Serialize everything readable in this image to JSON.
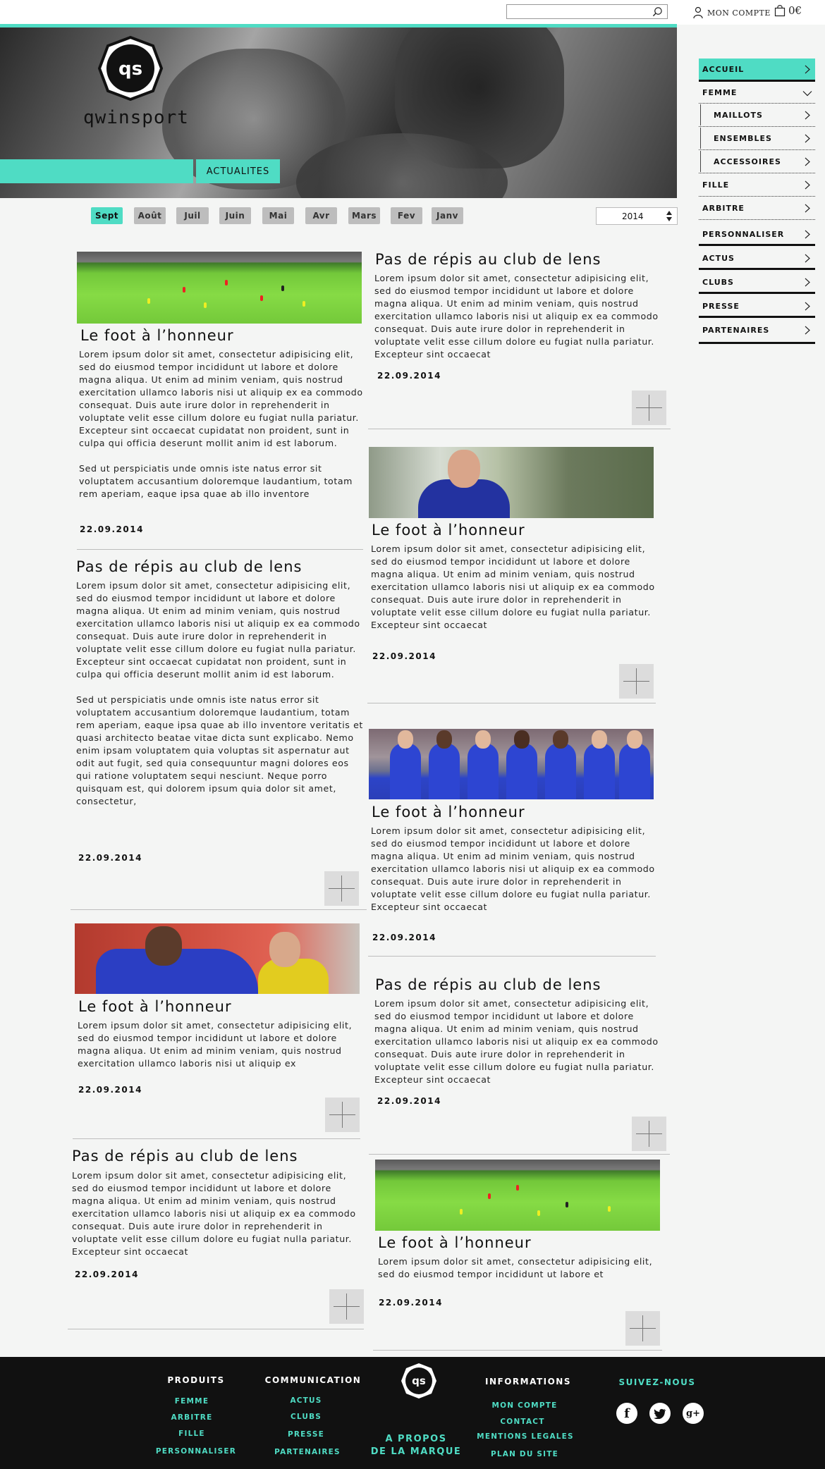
{
  "header": {
    "search_placeholder": "",
    "account_label": "MON COMPTE",
    "cart_total": "0€"
  },
  "hero": {
    "brand": "qwinsport",
    "logo_text": "qs",
    "section_tab": "ACTUALITES"
  },
  "filters": {
    "months": [
      "Sept",
      "Août",
      "Juil",
      "Juin",
      "Mai",
      "Avr",
      "Mars",
      "Fev",
      "Janv"
    ],
    "active_month": "Sept",
    "year": "2014"
  },
  "sidebar": {
    "items": [
      {
        "label": "ACCUEIL"
      },
      {
        "label": "FEMME"
      },
      {
        "label": "MAILLOTS"
      },
      {
        "label": "ENSEMBLES"
      },
      {
        "label": "ACCESSOIRES"
      },
      {
        "label": "FILLE"
      },
      {
        "label": "ARBITRE"
      },
      {
        "label": "PERSONNALISER"
      },
      {
        "label": "ACTUS"
      },
      {
        "label": "CLUBS"
      },
      {
        "label": "PRESSE"
      },
      {
        "label": "PARTENAIRES"
      }
    ]
  },
  "articles": [
    {
      "title": "Le foot à l’honneur",
      "paragraphs": [
        "Lorem ipsum dolor sit amet, consectetur adipisicing elit, sed do eiusmod tempor incididunt ut labore et dolore magna aliqua. Ut enim ad minim veniam, quis nostrud exercitation ullamco laboris nisi ut aliquip ex ea commodo consequat. Duis aute irure dolor in reprehenderit in voluptate velit esse cillum dolore eu fugiat nulla pariatur. Excepteur sint occaecat cupidatat non proident, sunt in culpa qui officia deserunt mollit anim id est laborum.",
        "Sed ut perspiciatis unde omnis iste natus error sit voluptatem accusantium doloremque laudantium, totam rem aperiam, eaque ipsa quae ab illo inventore"
      ],
      "date": "22.09.2014"
    },
    {
      "title": "Pas de répis au club de lens",
      "paragraphs": [
        "Lorem ipsum dolor sit amet, consectetur adipisicing elit, sed do eiusmod tempor incididunt ut labore et dolore magna aliqua. Ut enim ad minim veniam, quis nostrud exercitation ullamco laboris nisi ut aliquip ex ea commodo consequat. Duis aute irure dolor in reprehenderit in voluptate velit esse cillum dolore eu fugiat nulla pariatur. Excepteur sint occaecat"
      ],
      "date": "22.09.2014"
    },
    {
      "title": "Pas de répis au club de lens",
      "paragraphs": [
        "Lorem ipsum dolor sit amet, consectetur adipisicing elit, sed do eiusmod tempor incididunt ut labore et dolore magna aliqua. Ut enim ad minim veniam, quis nostrud exercitation ullamco laboris nisi ut aliquip ex ea commodo consequat. Duis aute irure dolor in reprehenderit in voluptate velit esse cillum dolore eu fugiat nulla pariatur. Excepteur sint occaecat cupidatat non proident, sunt in culpa qui officia deserunt mollit anim id est laborum.",
        "Sed ut perspiciatis unde omnis iste natus error sit voluptatem accusantium doloremque laudantium, totam rem aperiam, eaque ipsa quae ab illo inventore veritatis et quasi architecto beatae vitae dicta sunt explicabo. Nemo enim ipsam voluptatem quia voluptas sit aspernatur aut odit aut fugit, sed quia consequuntur magni dolores eos qui ratione voluptatem sequi nesciunt. Neque porro quisquam est, qui dolorem ipsum quia dolor sit amet, consectetur,"
      ],
      "date": "22.09.2014"
    },
    {
      "title": "Le foot à l’honneur",
      "paragraphs": [
        "Lorem ipsum dolor sit amet, consectetur adipisicing elit, sed do eiusmod tempor incididunt ut labore et dolore magna aliqua. Ut enim ad minim veniam, quis nostrud exercitation ullamco laboris nisi ut aliquip ex ea commodo consequat. Duis aute irure dolor in reprehenderit in voluptate velit esse cillum dolore eu fugiat nulla pariatur. Excepteur sint occaecat"
      ],
      "date": "22.09.2014"
    },
    {
      "title": "Le foot à l’honneur",
      "paragraphs": [
        "Lorem ipsum dolor sit amet, consectetur adipisicing elit, sed do eiusmod tempor incididunt ut labore et dolore magna aliqua. Ut enim ad minim veniam, quis nostrud exercitation ullamco laboris nisi ut aliquip ex ea commodo consequat. Duis aute irure dolor in reprehenderit in voluptate velit esse cillum dolore eu fugiat nulla pariatur. Excepteur sint occaecat"
      ],
      "date": "22.09.2014"
    },
    {
      "title": "Le foot à l’honneur",
      "paragraphs": [
        "Lorem ipsum dolor sit amet, consectetur adipisicing elit, sed do eiusmod tempor incididunt ut labore et dolore magna aliqua. Ut enim ad minim veniam, quis nostrud exercitation ullamco laboris nisi ut aliquip ex"
      ],
      "date": "22.09.2014"
    },
    {
      "title": "Pas de répis au club de lens",
      "paragraphs": [
        "Lorem ipsum dolor sit amet, consectetur adipisicing elit, sed do eiusmod tempor incididunt ut labore et dolore magna aliqua. Ut enim ad minim veniam, quis nostrud exercitation ullamco laboris nisi ut aliquip ex ea commodo consequat. Duis aute irure dolor in reprehenderit in voluptate velit esse cillum dolore eu fugiat nulla pariatur. Excepteur sint occaecat"
      ],
      "date": "22.09.2014"
    },
    {
      "title": "Pas de répis au club de lens",
      "paragraphs": [
        "Lorem ipsum dolor sit amet, consectetur adipisicing elit, sed do eiusmod tempor incididunt ut labore et dolore magna aliqua. Ut enim ad minim veniam, quis nostrud exercitation ullamco laboris nisi ut aliquip ex ea commodo consequat. Duis aute irure dolor in reprehenderit in voluptate velit esse cillum dolore eu fugiat nulla pariatur. Excepteur sint occaecat"
      ],
      "date": "22.09.2014"
    },
    {
      "title": "Le foot à l’honneur",
      "paragraphs": [
        "Lorem ipsum dolor sit amet, consectetur adipisicing elit, sed do eiusmod tempor incididunt ut labore et"
      ],
      "date": "22.09.2014"
    }
  ],
  "footer": {
    "produits": {
      "heading": "PRODUITS",
      "links": [
        "FEMME",
        "ARBITRE",
        "FILLE",
        "PERSONNALISER"
      ]
    },
    "communication": {
      "heading": "COMMUNICATION",
      "links": [
        "ACTUS",
        "CLUBS",
        "PRESSE",
        "PARTENAIRES"
      ]
    },
    "about": {
      "line1": "A PROPOS",
      "line2": "DE LA MARQUE"
    },
    "logo_text": "qs",
    "informations": {
      "heading": "INFORMATIONS",
      "links": [
        "MON COMPTE",
        "CONTACT",
        "MENTIONS LEGALES",
        "PLAN DU SITE"
      ]
    },
    "social": {
      "heading": "SUIVEZ-NOUS",
      "icons": [
        "facebook-icon",
        "twitter-icon",
        "google-plus-icon"
      ]
    }
  },
  "colors": {
    "accent": "#4fdcc4",
    "footer_bg": "#111111",
    "page_bg": "#f4f5f4"
  }
}
